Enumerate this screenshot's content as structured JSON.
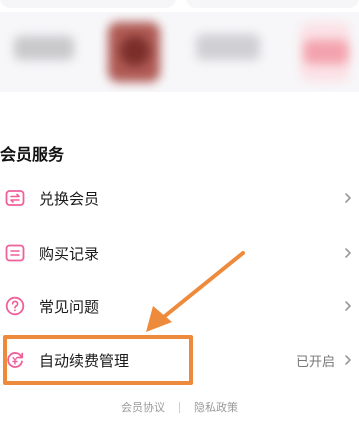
{
  "section": {
    "title": "会员服务"
  },
  "menu": [
    {
      "label": "兑换会员",
      "icon": "exchange-ticket-icon",
      "value": ""
    },
    {
      "label": "购买记录",
      "icon": "receipt-icon",
      "value": ""
    },
    {
      "label": "常见问题",
      "icon": "question-circle-icon",
      "value": ""
    },
    {
      "label": "自动续费管理",
      "icon": "auto-renew-icon",
      "value": "已开启"
    }
  ],
  "footer": {
    "agreement": "会员协议",
    "privacy": "隐私政策"
  },
  "colors": {
    "accent_pink": "#f0609a",
    "annotation_orange": "#ee8a3c",
    "muted_text": "#777777"
  }
}
